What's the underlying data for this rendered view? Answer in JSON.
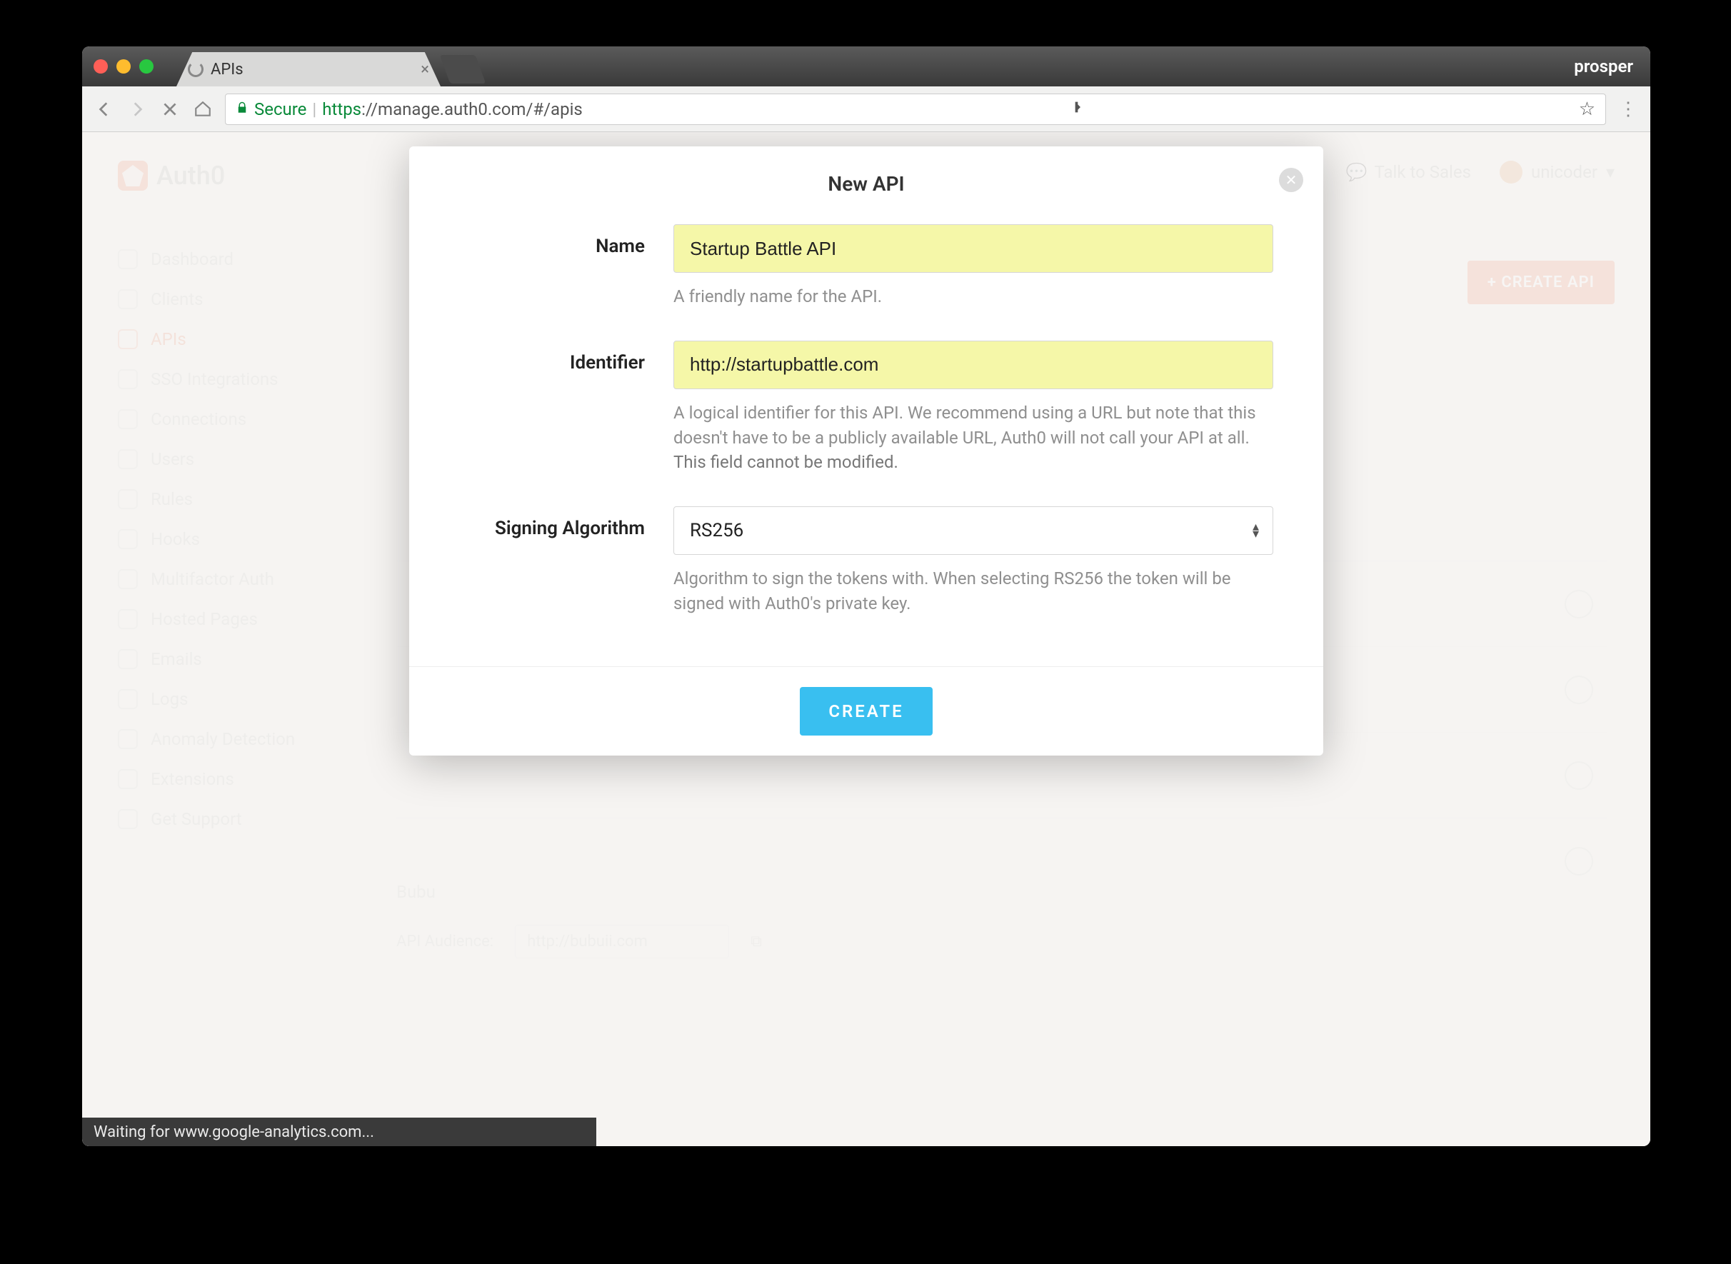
{
  "browser": {
    "tab_title": "APIs",
    "menubar_right": "prosper",
    "secure_label": "Secure",
    "url_scheme": "https",
    "url_rest": "://manage.auth0.com/#/apis",
    "status_text": "Waiting for www.google-analytics.com..."
  },
  "app": {
    "brand": "Auth0",
    "talk_to_sales": "Talk to Sales",
    "username": "unicoder",
    "create_api_button": "+ CREATE API",
    "sidebar": [
      "Dashboard",
      "Clients",
      "APIs",
      "SSO Integrations",
      "Connections",
      "Users",
      "Rules",
      "Hooks",
      "Multifactor Auth",
      "Hosted Pages",
      "Emails",
      "Logs",
      "Anomaly Detection",
      "Extensions",
      "Get Support"
    ],
    "sidebar_active_index": 2,
    "bg_client_name": "Bubu",
    "bg_audience_label": "API Audience:",
    "bg_audience_value": "http://bubuii.com"
  },
  "modal": {
    "title": "New API",
    "fields": {
      "name": {
        "label": "Name",
        "value": "Startup Battle API",
        "help": "A friendly name for the API."
      },
      "identifier": {
        "label": "Identifier",
        "value": "http://startupbattle.com",
        "help_pre": "A logical identifier for this API. We recommend using a URL but note that this doesn't have to be a publicly available URL, Auth0 will not call your API at all. ",
        "help_strong": "This field cannot be modified."
      },
      "algorithm": {
        "label": "Signing Algorithm",
        "value": "RS256",
        "help": "Algorithm to sign the tokens with. When selecting RS256 the token will be signed with Auth0's private key."
      }
    },
    "create_button": "CREATE"
  }
}
